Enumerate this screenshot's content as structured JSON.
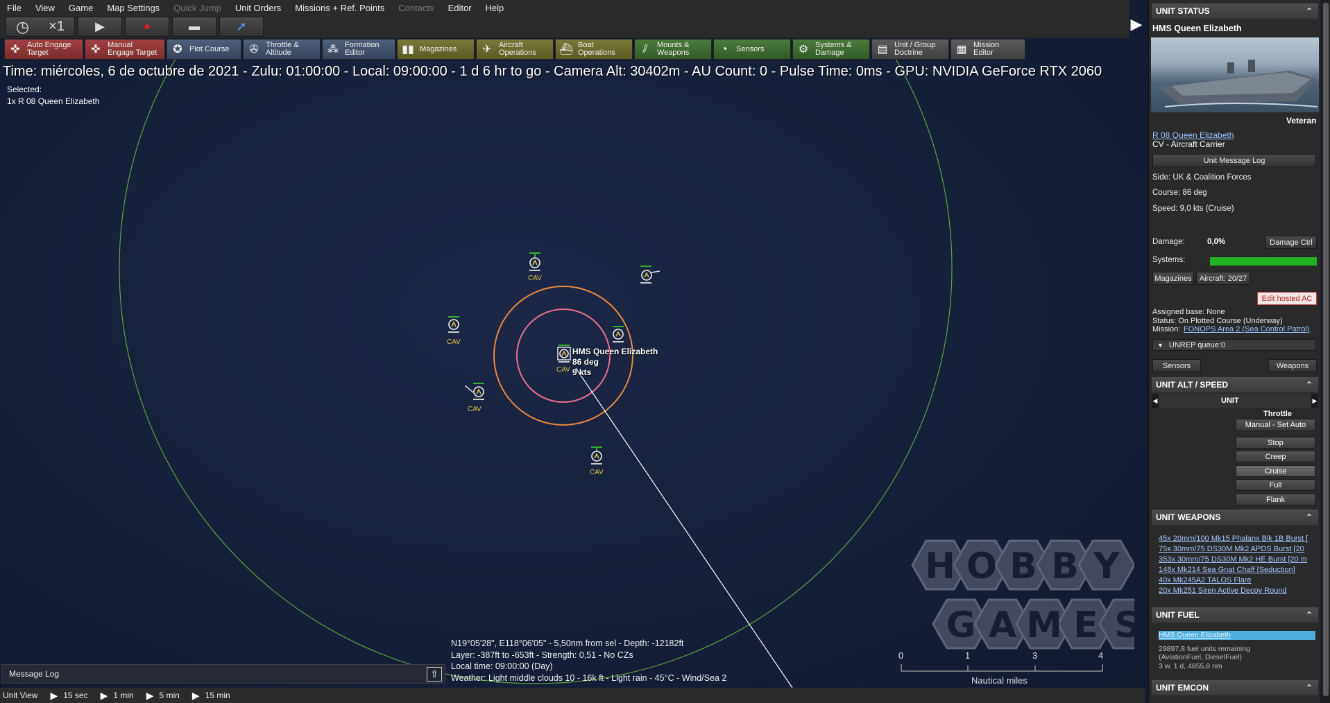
{
  "menu": [
    "File",
    "View",
    "Game",
    "Map Settings",
    "Quick Jump",
    "Unit Orders",
    "Missions + Ref. Points",
    "Contacts",
    "Editor",
    "Help"
  ],
  "sim": {
    "speed": "×1"
  },
  "toolbar": [
    {
      "l1": "Auto Engage",
      "l2": "Target",
      "color": "red",
      "icon": "crosshair-icon"
    },
    {
      "l1": "Manual",
      "l2": "Engage Target",
      "color": "red",
      "icon": "crosshair-icon"
    },
    {
      "l1": "Plot Course",
      "l2": "",
      "color": "blue",
      "icon": "compass-icon"
    },
    {
      "l1": "Throttle &",
      "l2": "Altitude",
      "color": "blue",
      "icon": "gauge-icon"
    },
    {
      "l1": "Formation",
      "l2": "Editor",
      "color": "blue",
      "icon": "formation-icon"
    },
    {
      "l1": "Magazines",
      "l2": "",
      "color": "olive",
      "icon": "ammo-icon"
    },
    {
      "l1": "Aircraft",
      "l2": "Operations",
      "color": "olive",
      "icon": "plane-icon"
    },
    {
      "l1": "Boat",
      "l2": "Operations",
      "color": "olive",
      "icon": "boat-icon"
    },
    {
      "l1": "Mounts &",
      "l2": "Weapons",
      "color": "green",
      "icon": "mounts-icon"
    },
    {
      "l1": "Sensors",
      "l2": "",
      "color": "green",
      "icon": "radar-icon"
    },
    {
      "l1": "Systems &",
      "l2": "Damage",
      "color": "green",
      "icon": "gear-icon"
    },
    {
      "l1": "Unit / Group",
      "l2": "Doctrine",
      "color": "gray",
      "icon": "doctrine-icon"
    },
    {
      "l1": "Mission",
      "l2": "Editor",
      "color": "gray",
      "icon": "mission-icon"
    }
  ],
  "info_line": "Time: miércoles, 6 de octubre de 2021 - Zulu: 01:00:00 - Local: 09:00:00 - 1 d 6 hr to go -  Camera Alt: 30402m  - AU Count: 0 - Pulse Time: 0ms - GPU: NVIDIA GeForce RTX 2060",
  "selected": {
    "label": "Selected:",
    "value": "1x R 08 Queen Elizabeth"
  },
  "map": {
    "ship_label": {
      "name": "HMS Queen Elizabeth",
      "course": "86 deg",
      "speed": "9 kts"
    },
    "cav_label": "CAV",
    "cursor_info": [
      "N19°05'28\", E118°06'05\" - 5,50nm from sel - Depth: -12182ft",
      "Layer: -387ft to -653ft - Strength: 0,51 - No CZs",
      "Local time: 09:00:00 (Day)",
      "Weather: Light middle clouds 10 - 16k ft - Light rain - 45°C - Wind/Sea 2"
    ],
    "scale": {
      "ticks": [
        "0",
        "1",
        "3",
        "4"
      ],
      "unit": "Nautical miles"
    },
    "watermark_letters": [
      "H",
      "O",
      "B",
      "B",
      "Y",
      "G",
      "A",
      "M",
      "E",
      "S"
    ]
  },
  "message_log": "Message Log",
  "bottombar": {
    "label": "Unit View",
    "steps": [
      "15 sec",
      "1 min",
      "5 min",
      "15 min"
    ]
  },
  "panel": {
    "unit_status": "UNIT STATUS",
    "unit_name": "HMS Queen Elizabeth",
    "rating": "Veteran",
    "class_link": "R 08 Queen Elizabeth",
    "type": "CV - Aircraft Carrier",
    "msg_log_btn": "Unit Message Log",
    "side": "Side: UK & Coalition Forces",
    "course": "Course: 86 deg",
    "speed": "Speed: 9,0 kts (Cruise)",
    "damage_label": "Damage:",
    "damage_value": "0,0%",
    "damage_btn": "Damage Ctrl",
    "systems_label": "Systems:",
    "systems_level": 1.0,
    "magazines_btn": "Magazines",
    "aircraft_btn": "Aircraft: 20/27",
    "edit_hosted_btn": "Edit hosted AC",
    "assigned_base": "Assigned base: None",
    "status": "Status: On Plotted Course (Underway)",
    "mission_label": "Mission:",
    "mission_link": "FONOPS Area 2 (Sea Control Patrol)",
    "unrep": "UNREP queue:0",
    "sensors_btn": "Sensors",
    "weapons_btn": "Weapons",
    "alt_speed": "UNIT ALT / SPEED",
    "unit_tab": "UNIT",
    "throttle_title": "Throttle",
    "manual_btn": "Manual - Set Auto",
    "throttle_options": [
      "Stop",
      "Creep",
      "Cruise",
      "Full",
      "Flank"
    ],
    "weapons_head": "UNIT WEAPONS",
    "weapons": [
      "45x 20mm/100 Mk15 Phalanx Blk 1B Burst [",
      "75x 30mm/75 DS30M Mk2 APDS Burst [20",
      "353x 30mm/75 DS30M Mk2 HE Burst [20 m",
      "148x Mk214 Sea Gnat Chaff [Seduction]",
      "40x Mk245A2 TALOS Flare",
      "20x Mk251 Siren Active Decoy Round"
    ],
    "fuel_head": "UNIT FUEL",
    "fuel_link": "HMS Queen Elizabeth",
    "fuel_lines": [
      "29897,8 fuel units remaining",
      "(AviationFuel, DieselFuel)",
      "3 w, 1 d, 4855,8 nm"
    ],
    "emcon_head": "UNIT EMCON"
  }
}
